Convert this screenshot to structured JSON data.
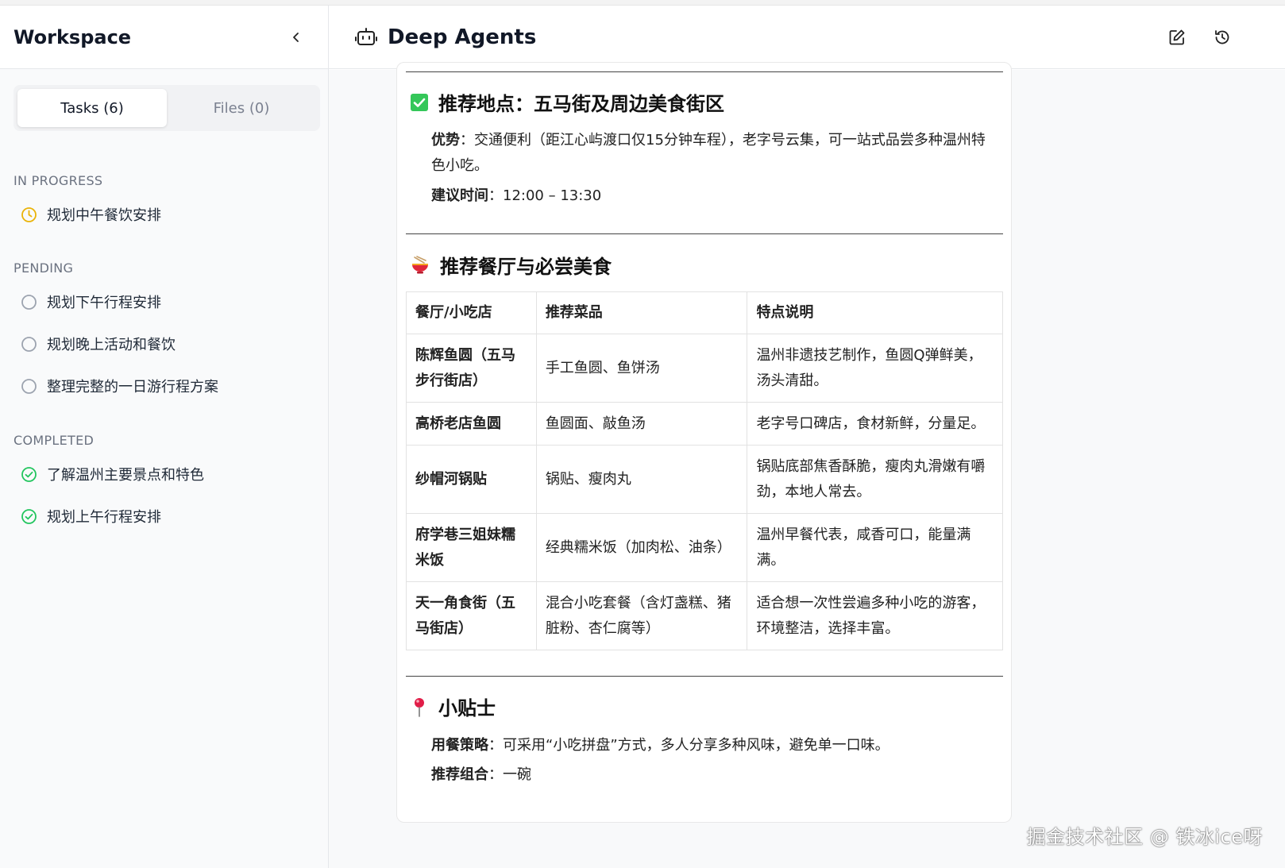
{
  "sidebar": {
    "title": "Workspace",
    "tabs": [
      {
        "label": "Tasks (6)",
        "active": true
      },
      {
        "label": "Files (0)",
        "active": false
      }
    ],
    "sections": {
      "in_progress": {
        "label": "IN PROGRESS",
        "items": [
          "规划中午餐饮安排"
        ]
      },
      "pending": {
        "label": "PENDING",
        "items": [
          "规划下午行程安排",
          "规划晚上活动和餐饮",
          "整理完整的一日游行程方案"
        ]
      },
      "completed": {
        "label": "COMPLETED",
        "items": [
          "了解温州主要景点和特色",
          "规划上午行程安排"
        ]
      }
    }
  },
  "header": {
    "title": "Deep Agents"
  },
  "content": {
    "location": {
      "heading": "推荐地点：五马街及周边美食街区",
      "advantage_label": "优势",
      "advantage_text": "：交通便利（距江心屿渡口仅15分钟车程），老字号云集，可一站式品尝多种温州特色小吃。",
      "time_label": "建议时间",
      "time_text": "：12:00 – 13:30"
    },
    "restaurants": {
      "heading": "推荐餐厅与必尝美食",
      "columns": [
        "餐厅/小吃店",
        "推荐菜品",
        "特点说明"
      ],
      "rows": [
        {
          "name": "陈辉鱼圆（五马步行街店）",
          "dish": "手工鱼圆、鱼饼汤",
          "note": "温州非遗技艺制作，鱼圆Q弹鲜美，汤头清甜。"
        },
        {
          "name": "高桥老店鱼圆",
          "dish": "鱼圆面、敲鱼汤",
          "note": "老字号口碑店，食材新鲜，分量足。"
        },
        {
          "name": "纱帽河锅贴",
          "dish": "锅贴、瘦肉丸",
          "note": "锅贴底部焦香酥脆，瘦肉丸滑嫩有嚼劲，本地人常去。"
        },
        {
          "name": "府学巷三姐妹糯米饭",
          "dish": "经典糯米饭（加肉松、油条）",
          "note": "温州早餐代表，咸香可口，能量满满。"
        },
        {
          "name": "天一角食街（五马街店）",
          "dish": "混合小吃套餐（含灯盏糕、猪脏粉、杏仁腐等）",
          "note": "适合想一次性尝遍多种小吃的游客，环境整洁，选择丰富。"
        }
      ]
    },
    "tips": {
      "heading": "小贴士",
      "strategy_label": "用餐策略",
      "strategy_text": "：可采用“小吃拼盘”方式，多人分享多种风味，避免单一口味。",
      "combo_label": "推荐组合",
      "combo_text": "：一碗"
    }
  },
  "watermark": "掘金技术社区 @ 铁冰ice呀",
  "colors": {
    "in_progress": "#eab308",
    "pending": "#9ca3af",
    "completed": "#22c55e",
    "check_box": "#34c759"
  }
}
